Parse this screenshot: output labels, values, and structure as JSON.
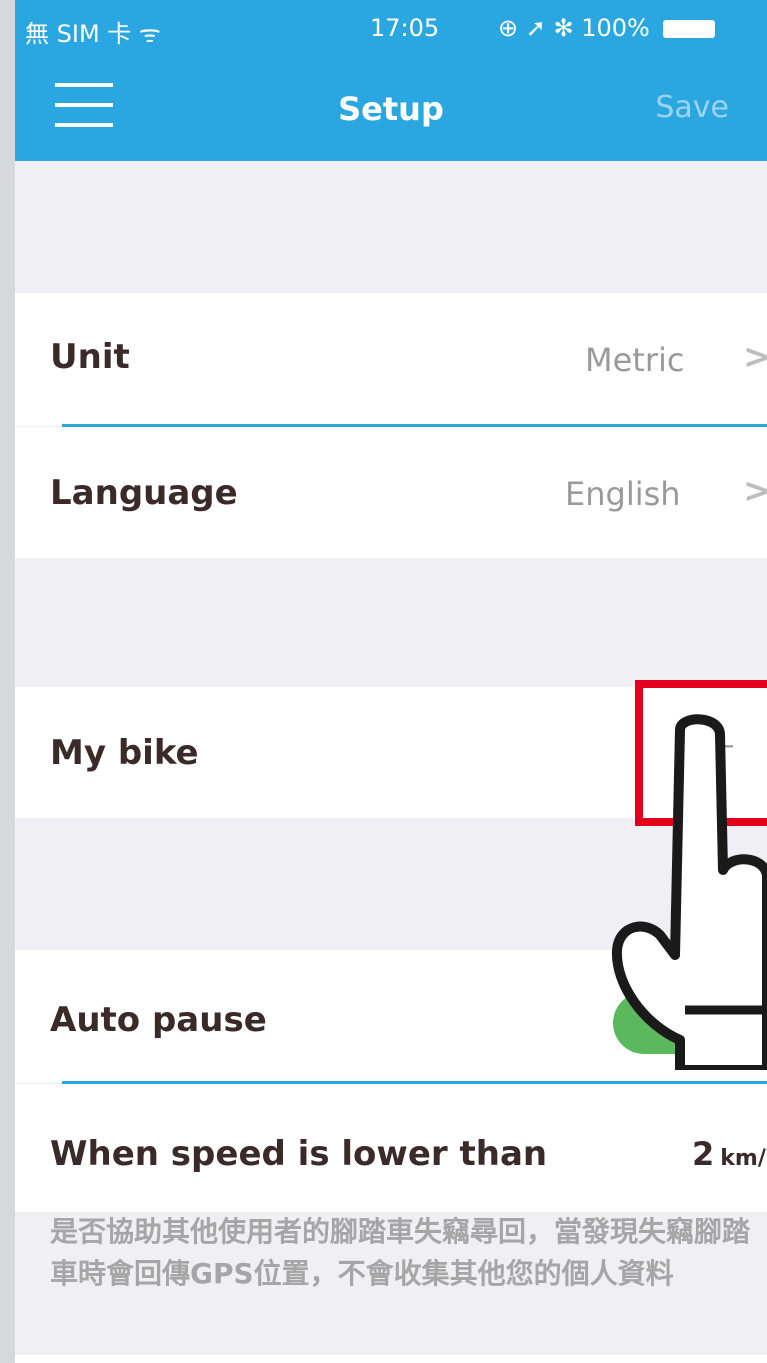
{
  "status": {
    "carrier": "無 SIM 卡 ᯤ",
    "time": "17:05",
    "right": "⊕ ➚ ✻ 100%"
  },
  "nav": {
    "title": "Setup",
    "save_label": "Save"
  },
  "settings": {
    "unit": {
      "label": "Unit",
      "value": "Metric"
    },
    "language": {
      "label": "Language",
      "value": "English"
    },
    "my_bike": {
      "label": "My bike"
    },
    "auto_pause": {
      "label": "Auto pause",
      "enabled": true
    },
    "speed": {
      "label": "When speed is lower than",
      "value": "2",
      "unit": "km/h"
    }
  },
  "note": "是否協助其他使用者的腳踏車失竊尋回，當發現失竊腳踏車時會回傳GPS位置，不會收集其他您的個人資料",
  "colors": {
    "accent": "#2aa6e0",
    "highlight": "#e3001b",
    "toggle_on": "#5cb85c"
  }
}
